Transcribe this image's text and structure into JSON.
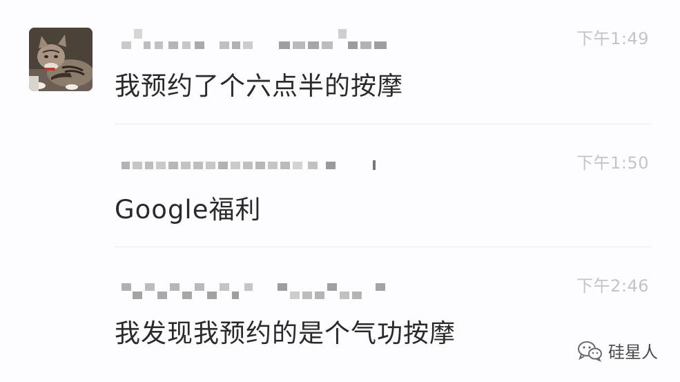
{
  "messages": [
    {
      "time": "下午1:49",
      "text": "我预约了个六点半的按摩"
    },
    {
      "time": "下午1:50",
      "text": "Google福利"
    },
    {
      "time": "下午2:46",
      "text": "我发现我预约的是个气功按摩"
    }
  ],
  "watermark": {
    "label": "硅星人",
    "icon": "wechat-icon"
  }
}
